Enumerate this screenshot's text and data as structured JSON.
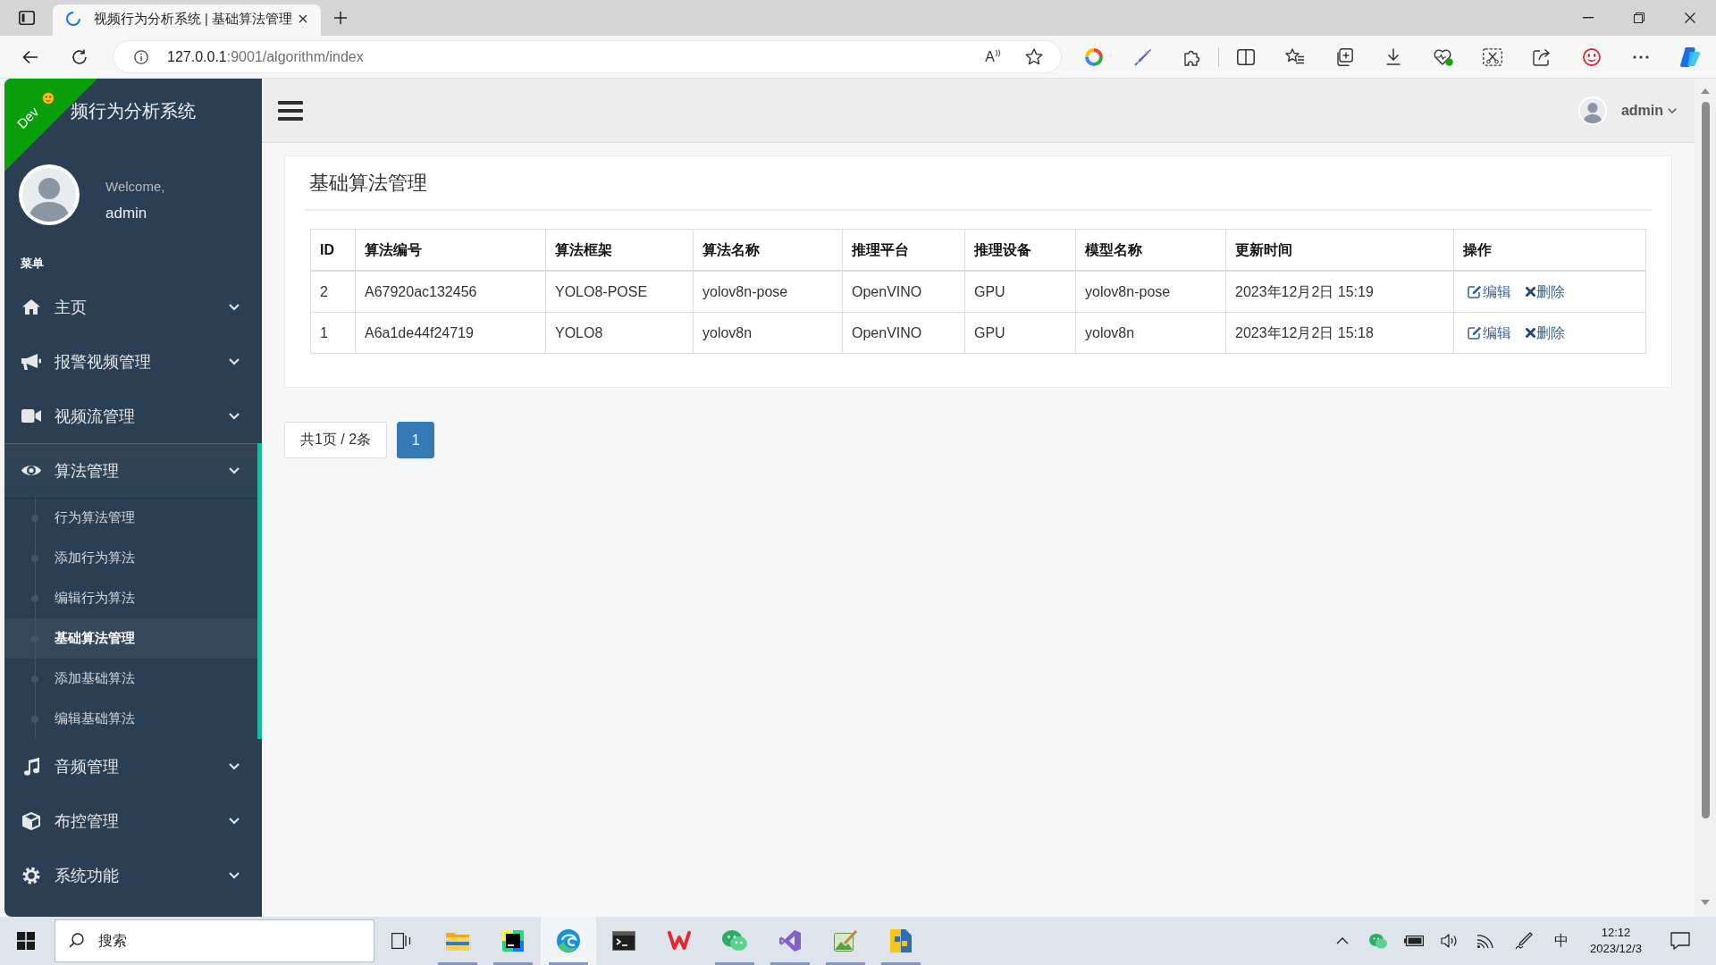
{
  "browser": {
    "tab": {
      "title": "视频行为分析系统 | 基础算法管理",
      "selected": true
    },
    "address": {
      "host": "127.0.0.1",
      "path": ":9001/algorithm/index"
    },
    "read_aloud": {
      "label": "A"
    }
  },
  "sidebar": {
    "ribbon": {
      "label": "Dev"
    },
    "site_title": "频行为分析系统",
    "profile": {
      "greeting": "Welcome,",
      "name": "admin"
    },
    "menu_label": "菜单",
    "items": [
      {
        "label": "主页",
        "selected": false
      },
      {
        "label": "报警视频管理",
        "selected": false
      },
      {
        "label": "视频流管理",
        "selected": false
      },
      {
        "label": "算法管理",
        "selected": true,
        "children": [
          {
            "label": "行为算法管理",
            "selected": false
          },
          {
            "label": "添加行为算法",
            "selected": false
          },
          {
            "label": "编辑行为算法",
            "selected": false
          },
          {
            "label": "基础算法管理",
            "selected": true
          },
          {
            "label": "添加基础算法",
            "selected": false
          },
          {
            "label": "编辑基础算法",
            "selected": false
          }
        ]
      },
      {
        "label": "音频管理",
        "selected": false
      },
      {
        "label": "布控管理",
        "selected": false
      },
      {
        "label": "系统功能",
        "selected": false
      }
    ]
  },
  "header": {
    "user": {
      "name": "admin"
    }
  },
  "content": {
    "title": "基础算法管理",
    "table": {
      "columns": [
        "ID",
        "算法编号",
        "算法框架",
        "算法名称",
        "推理平台",
        "推理设备",
        "模型名称",
        "更新时间",
        "操作"
      ],
      "rows": [
        {
          "cells": [
            "2",
            "A67920ac132456",
            "YOLO8-POSE",
            "yolov8n-pose",
            "OpenVINO",
            "GPU",
            "yolov8n-pose",
            "2023年12月2日 15:19"
          ],
          "actions": [
            {
              "kind": "edit",
              "label": "编辑"
            },
            {
              "kind": "delete",
              "label": "删除"
            }
          ]
        },
        {
          "cells": [
            "1",
            "A6a1de44f24719",
            "YOLO8",
            "yolov8n",
            "OpenVINO",
            "GPU",
            "yolov8n",
            "2023年12月2日 15:18"
          ],
          "actions": [
            {
              "kind": "edit",
              "label": "编辑"
            },
            {
              "kind": "delete",
              "label": "删除"
            }
          ]
        }
      ]
    },
    "pagination": {
      "summary": "共1页 / 2条",
      "pages": [
        {
          "label": "1",
          "selected": true
        }
      ]
    }
  },
  "taskbar": {
    "search": {
      "placeholder": "搜索"
    },
    "apps": [
      {
        "running": true,
        "selected": false
      },
      {
        "running": true,
        "selected": false
      },
      {
        "running": true,
        "selected": true
      },
      {
        "running": false,
        "selected": false
      },
      {
        "running": false,
        "selected": false
      },
      {
        "running": true,
        "selected": false
      },
      {
        "running": true,
        "selected": false
      },
      {
        "running": true,
        "selected": false
      },
      {
        "running": true,
        "selected": false
      }
    ],
    "ime": "中",
    "clock": {
      "time": "12:12",
      "date": "2023/12/3"
    }
  }
}
